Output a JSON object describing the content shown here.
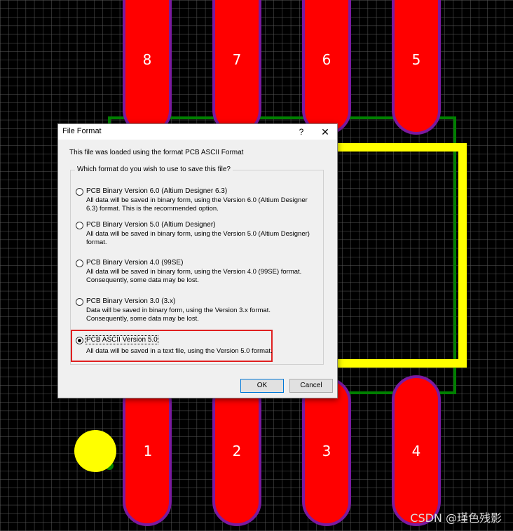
{
  "pcb": {
    "pads_top": [
      "8",
      "7",
      "6",
      "5"
    ],
    "pads_bottom": [
      "1",
      "2",
      "3",
      "4"
    ],
    "colors": {
      "background": "#000000",
      "grid": "#5a5a5a",
      "pad": "#ff0000",
      "pad_outline": "#7a1aa0",
      "silkscreen": "#ffff00",
      "outline": "#008000",
      "pin1_marker": "#ffff00"
    }
  },
  "watermark": "CSDN @瑾色残影",
  "dialog": {
    "title": "File Format",
    "help_glyph": "?",
    "close_glyph": "✕",
    "info": "This file was loaded using the format PCB ASCII Format",
    "group_label": "Which format do you wish to use to save this file?",
    "options": [
      {
        "label": "PCB Binary Version 6.0 (Altium Designer 6.3)",
        "desc": "All data will be saved in binary form, using the Version 6.0 (Altium Designer 6.3) format. This is the recommended option."
      },
      {
        "label": "PCB Binary Version 5.0 (Altium Designer)",
        "desc": "All data will be saved in binary form, using the Version 5.0 (Altium Designer) format."
      },
      {
        "label": "PCB Binary Version 4.0 (99SE)",
        "desc": "All data will be saved in binary form, using the Version 4.0 (99SE) format. Consequently, some data may be lost."
      },
      {
        "label": "PCB Binary Version 3.0 (3.x)",
        "desc": "Data will be saved in binary form, using the Version 3.x format. Consequently, some data may be lost."
      },
      {
        "label": "PCB ASCII Version 5.0",
        "desc": "All data will be saved in a text file, using the Version 5.0 format."
      }
    ],
    "selected_index": 4,
    "ok_label": "OK",
    "cancel_label": "Cancel"
  }
}
